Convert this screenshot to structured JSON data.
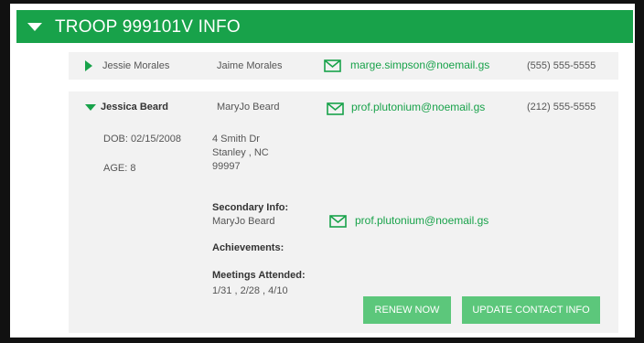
{
  "header": {
    "title": "TROOP 999101V INFO"
  },
  "scouts": [
    {
      "name": "Jessie Morales",
      "parent": "Jaime Morales",
      "email": "marge.simpson@noemail.gs",
      "phone": "(555) 555-5555"
    },
    {
      "name": "Jessica Beard",
      "parent": "MaryJo Beard",
      "email": "prof.plutonium@noemail.gs",
      "phone": "(212) 555-5555",
      "dob": "DOB: 02/15/2008",
      "age": "AGE: 8",
      "address": {
        "line1": "4 Smith Dr",
        "line2": "Stanley , NC",
        "line3": "99997"
      },
      "secondary": {
        "label": "Secondary Info:",
        "name": "MaryJo Beard",
        "email": "prof.plutonium@noemail.gs"
      },
      "achievements_label": "Achievements:",
      "meetings": {
        "label": "Meetings Attended:",
        "value": "1/31 , 2/28 , 4/10"
      }
    }
  ],
  "buttons": {
    "renew": "RENEW NOW",
    "update": "UPDATE CONTACT INFO"
  },
  "colors": {
    "accent": "#18a24a",
    "button": "#5cc77b",
    "card": "#f2f2f2"
  }
}
